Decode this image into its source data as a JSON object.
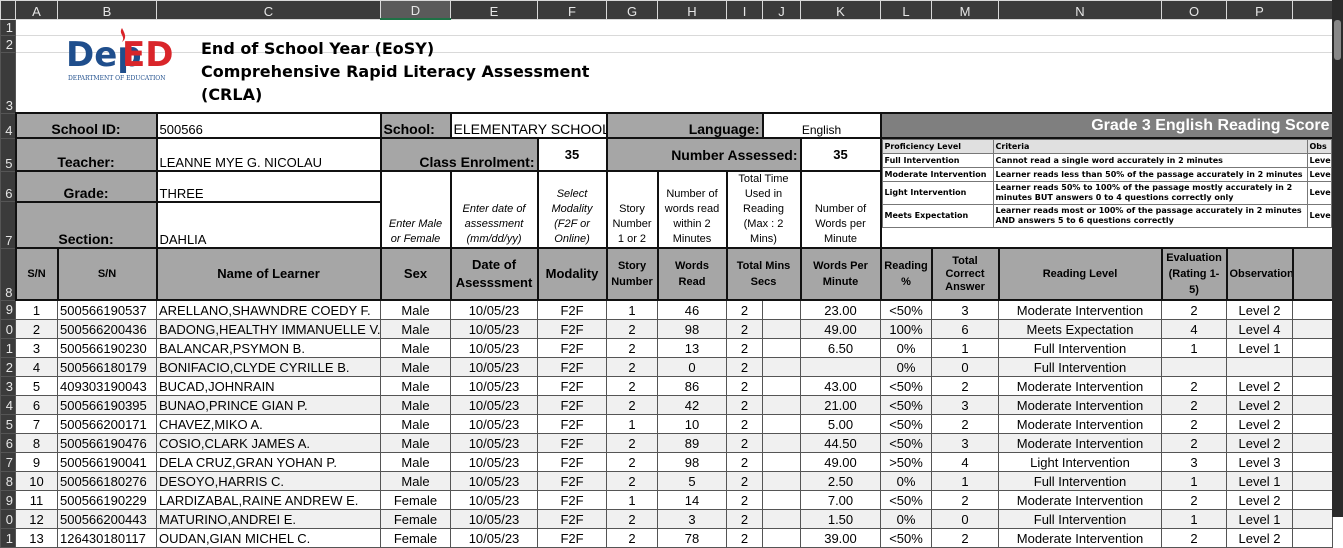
{
  "columns": [
    "A",
    "B",
    "C",
    "D",
    "E",
    "F",
    "G",
    "H",
    "I",
    "J",
    "K",
    "L",
    "M",
    "N",
    "O",
    "P"
  ],
  "row_numbers": [
    "1",
    "2",
    "3",
    "4",
    "5",
    "6",
    "7",
    "8"
  ],
  "logo": {
    "text_dep": "Dep",
    "text_ed": "ED",
    "subtitle": "DEPARTMENT OF EDUCATION"
  },
  "title": {
    "line1": "End of School Year (EoSY)",
    "line2": "Comprehensive Rapid Literacy Assessment",
    "line3": "(CRLA)"
  },
  "info": {
    "school_id_label": "School ID:",
    "school_id": "500566",
    "school_label": "School:",
    "school": "ELEMENTARY SCHOOL",
    "language_label": "Language:",
    "language": "English",
    "teacher_label": "Teacher:",
    "teacher": "LEANNE MYE G. NICOLAU",
    "enrolment_label": "Class Enrolment:",
    "enrolment": "35",
    "assessed_label": "Number Assessed:",
    "assessed": "35",
    "grade_label": "Grade:",
    "grade": "THREE",
    "section_label": "Section:",
    "section": "DAHLIA"
  },
  "score_title": "Grade 3 English Reading Score",
  "criteria": {
    "headers": [
      "Proficiency Level",
      "Criteria",
      "Obs"
    ],
    "rows": [
      {
        "level": "Full Intervention",
        "criteria": "Cannot read a single word accurately in 2 minutes",
        "obs": "Leve"
      },
      {
        "level": "Moderate Intervention",
        "criteria": "Learner reads less than 50% of the passage accurately in 2 minutes",
        "obs": "Leve"
      },
      {
        "level": "Light Intervention",
        "criteria": "Learner reads 50% to 100% of the passage mostly accurately in 2 minutes BUT answers 0 to 4 questions correctly only",
        "obs": "Leve"
      },
      {
        "level": "Meets Expectation",
        "criteria": "Learner reads most or 100% of the passage accurately in 2 minutes AND answers 5 to 6  questions correctly",
        "obs": "Leve"
      }
    ]
  },
  "instructions": {
    "sex": "Enter Male or Female",
    "date": "Enter date of assessment (mm/dd/yy)",
    "modality": "Select Modality (F2F or Online)",
    "story": "Story Number 1 or 2",
    "words": "Number of words read within 2 Minutes",
    "time": "Total Time Used in Reading (Max : 2 Mins)",
    "wpm": "Number of Words per Minute"
  },
  "headers": {
    "sn1": "S/N",
    "sn2": "S/N",
    "name": "Name of Learner",
    "sex": "Sex",
    "date": "Date of Asesssment",
    "modality": "Modality",
    "story": "Story Number",
    "words": "Words Read",
    "time": "Total Mins  Secs",
    "wpm": "Words Per Minute",
    "reading_pct": "Reading %",
    "correct": "Total Correct Answer",
    "level": "Reading Level",
    "evaluation": "Evaluation (Rating 1-5)",
    "observation": "Observation"
  },
  "rows": [
    {
      "rn": "9",
      "sn": "1",
      "lrn": "500566190537",
      "name": "ARELLANO,SHAWNDRE COEDY F.",
      "sex": "Male",
      "date": "10/05/23",
      "mod": "F2F",
      "story": "1",
      "words": "46",
      "mins": "2",
      "secs": "",
      "wpm": "23.00",
      "pct": "<50%",
      "correct": "3",
      "level": "Moderate Intervention",
      "eval": "2",
      "obs": "Level 2"
    },
    {
      "rn": "0",
      "sn": "2",
      "lrn": "500566200436",
      "name": "BADONG,HEALTHY IMMANUELLE V.",
      "sex": "Male",
      "date": "10/05/23",
      "mod": "F2F",
      "story": "2",
      "words": "98",
      "mins": "2",
      "secs": "",
      "wpm": "49.00",
      "pct": "100%",
      "correct": "6",
      "level": "Meets Expectation",
      "eval": "4",
      "obs": "Level 4"
    },
    {
      "rn": "1",
      "sn": "3",
      "lrn": "500566190230",
      "name": "BALANCAR,PSYMON B.",
      "sex": "Male",
      "date": "10/05/23",
      "mod": "F2F",
      "story": "2",
      "words": "13",
      "mins": "2",
      "secs": "",
      "wpm": "6.50",
      "pct": "0%",
      "correct": "1",
      "level": "Full Intervention",
      "eval": "1",
      "obs": "Level 1"
    },
    {
      "rn": "2",
      "sn": "4",
      "lrn": "500566180179",
      "name": "BONIFACIO,CLYDE CYRILLE B.",
      "sex": "Male",
      "date": "10/05/23",
      "mod": "F2F",
      "story": "2",
      "words": "0",
      "mins": "2",
      "secs": "",
      "wpm": "",
      "pct": "0%",
      "correct": "0",
      "level": "Full Intervention",
      "eval": "",
      "obs": ""
    },
    {
      "rn": "3",
      "sn": "5",
      "lrn": "409303190043",
      "name": "BUCAD,JOHNRAIN",
      "sex": "Male",
      "date": "10/05/23",
      "mod": "F2F",
      "story": "2",
      "words": "86",
      "mins": "2",
      "secs": "",
      "wpm": "43.00",
      "pct": "<50%",
      "correct": "2",
      "level": "Moderate Intervention",
      "eval": "2",
      "obs": "Level 2"
    },
    {
      "rn": "4",
      "sn": "6",
      "lrn": "500566190395",
      "name": "BUNAO,PRINCE GIAN P.",
      "sex": "Male",
      "date": "10/05/23",
      "mod": "F2F",
      "story": "2",
      "words": "42",
      "mins": "2",
      "secs": "",
      "wpm": "21.00",
      "pct": "<50%",
      "correct": "3",
      "level": "Moderate Intervention",
      "eval": "2",
      "obs": "Level 2"
    },
    {
      "rn": "5",
      "sn": "7",
      "lrn": "500566200171",
      "name": "CHAVEZ,MIKO A.",
      "sex": "Male",
      "date": "10/05/23",
      "mod": "F2F",
      "story": "1",
      "words": "10",
      "mins": "2",
      "secs": "",
      "wpm": "5.00",
      "pct": "<50%",
      "correct": "2",
      "level": "Moderate Intervention",
      "eval": "2",
      "obs": "Level 2"
    },
    {
      "rn": "6",
      "sn": "8",
      "lrn": "500566190476",
      "name": "COSIO,CLARK JAMES A.",
      "sex": "Male",
      "date": "10/05/23",
      "mod": "F2F",
      "story": "2",
      "words": "89",
      "mins": "2",
      "secs": "",
      "wpm": "44.50",
      "pct": "<50%",
      "correct": "3",
      "level": "Moderate Intervention",
      "eval": "2",
      "obs": "Level 2"
    },
    {
      "rn": "7",
      "sn": "9",
      "lrn": "500566190041",
      "name": "DELA CRUZ,GRAN YOHAN P.",
      "sex": "Male",
      "date": "10/05/23",
      "mod": "F2F",
      "story": "2",
      "words": "98",
      "mins": "2",
      "secs": "",
      "wpm": "49.00",
      "pct": ">50%",
      "correct": "4",
      "level": "Light Intervention",
      "eval": "3",
      "obs": "Level 3"
    },
    {
      "rn": "8",
      "sn": "10",
      "lrn": "500566180276",
      "name": "DESOYO,HARRIS C.",
      "sex": "Male",
      "date": "10/05/23",
      "mod": "F2F",
      "story": "2",
      "words": "5",
      "mins": "2",
      "secs": "",
      "wpm": "2.50",
      "pct": "0%",
      "correct": "1",
      "level": "Full Intervention",
      "eval": "1",
      "obs": "Level 1"
    },
    {
      "rn": "9",
      "sn": "11",
      "lrn": "500566190229",
      "name": "LARDIZABAL,RAINE ANDREW E.",
      "sex": "Female",
      "date": "10/05/23",
      "mod": "F2F",
      "story": "1",
      "words": "14",
      "mins": "2",
      "secs": "",
      "wpm": "7.00",
      "pct": "<50%",
      "correct": "2",
      "level": "Moderate Intervention",
      "eval": "2",
      "obs": "Level 2"
    },
    {
      "rn": "0",
      "sn": "12",
      "lrn": "500566200443",
      "name": "MATURINO,ANDREI E.",
      "sex": "Female",
      "date": "10/05/23",
      "mod": "F2F",
      "story": "2",
      "words": "3",
      "mins": "2",
      "secs": "",
      "wpm": "1.50",
      "pct": "0%",
      "correct": "0",
      "level": "Full Intervention",
      "eval": "1",
      "obs": "Level 1"
    },
    {
      "rn": "1",
      "sn": "13",
      "lrn": "126430180117",
      "name": "OUDAN,GIAN MICHEL C.",
      "sex": "Female",
      "date": "10/05/23",
      "mod": "F2F",
      "story": "2",
      "words": "78",
      "mins": "2",
      "secs": "",
      "wpm": "39.00",
      "pct": "<50%",
      "correct": "2",
      "level": "Moderate Intervention",
      "eval": "2",
      "obs": "Level 2"
    }
  ]
}
